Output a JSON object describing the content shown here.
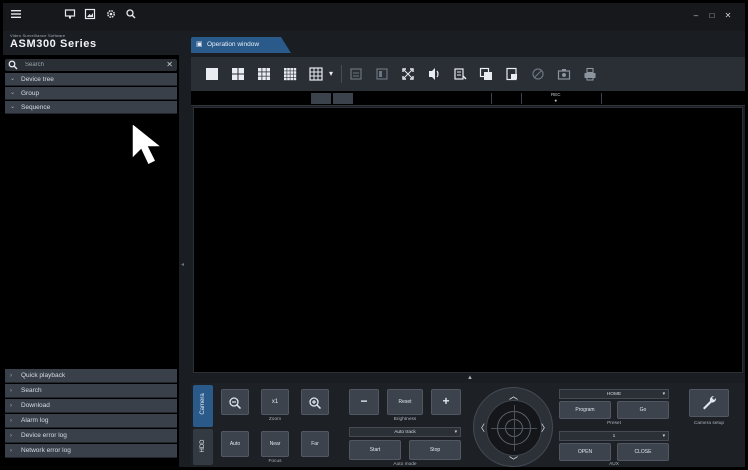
{
  "app": {
    "brand_small": "Video Surveillance Software",
    "brand": "ASM300 Series"
  },
  "titlebar": {
    "icons": [
      "menu-icon",
      "monitor-icon",
      "image-icon",
      "settings-gear-icon",
      "search-icon"
    ],
    "window_controls": [
      "–",
      "□",
      "✕"
    ]
  },
  "left_panel": {
    "search_placeholder": "Search",
    "clear_symbol": "✕",
    "tree": [
      {
        "label": "Device tree"
      },
      {
        "label": "Group"
      },
      {
        "label": "Sequence"
      }
    ],
    "bottom_menu": [
      {
        "label": "Quick playback"
      },
      {
        "label": "Search"
      },
      {
        "label": "Download"
      },
      {
        "label": "Alarm log"
      },
      {
        "label": "Device error log"
      },
      {
        "label": "Network error log"
      }
    ]
  },
  "tab": {
    "label": "Operation window"
  },
  "statusbar": {
    "rec_label": "REC"
  },
  "ptz": {
    "side_tabs": [
      "Camera",
      "HDD"
    ],
    "zoom": {
      "minus": "−",
      "x1": "x1",
      "plus": "+",
      "label": "Zoom"
    },
    "focus": {
      "auto": "Auto",
      "near": "Near",
      "far": "Far",
      "label": "Focus"
    },
    "brightness": {
      "minus": "−",
      "reset": "Reset",
      "plus": "+",
      "label": "Brightness"
    },
    "auto_mode": {
      "select": "Auto track",
      "start": "Start",
      "stop": "Stop",
      "label": "Auto mode"
    },
    "preset": {
      "home": "HOME",
      "program": "Program",
      "go": "Go",
      "label": "Preset"
    },
    "aux": {
      "value": "1",
      "open": "OPEN",
      "close": "CLOSE",
      "label": "AUX"
    },
    "camera_setup": "Camera setup"
  },
  "colors": {
    "tab_active": "#2a5a8a",
    "panel_item": "#3a4049",
    "background": "#000000"
  }
}
